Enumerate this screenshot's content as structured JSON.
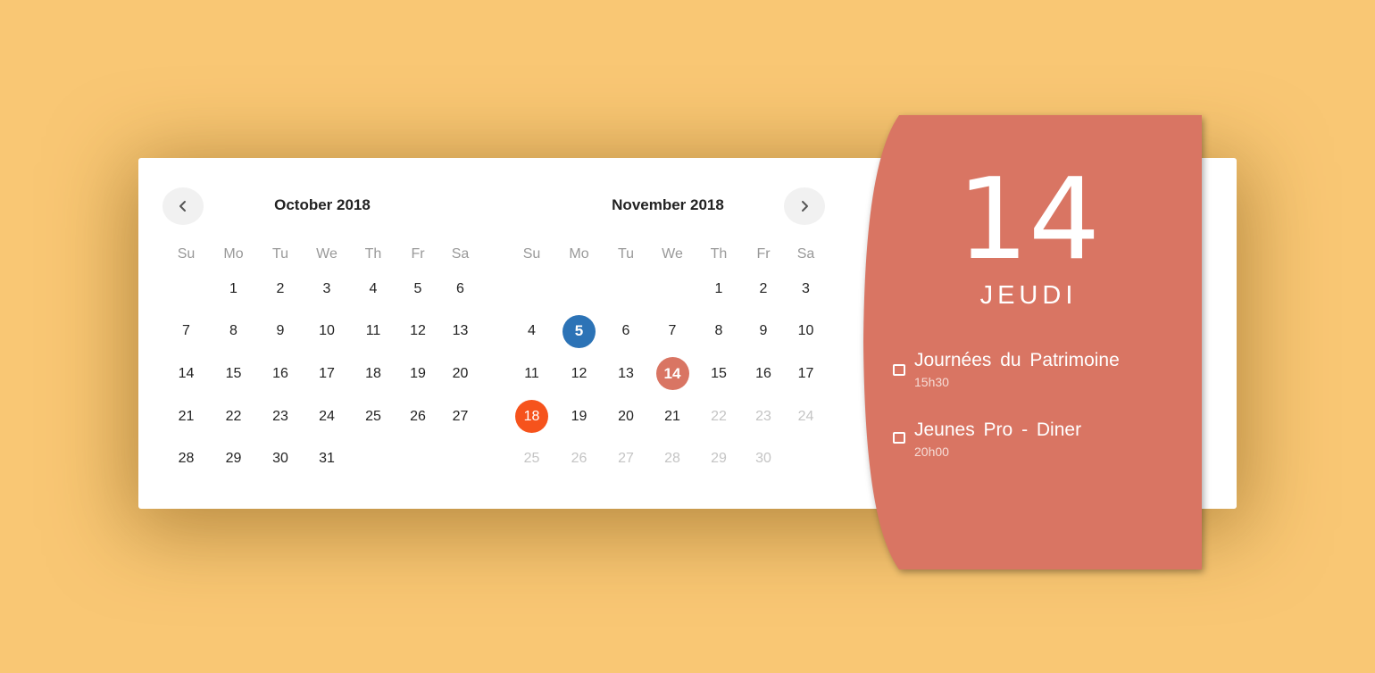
{
  "calendar": {
    "prev_icon": "chevron-left-icon",
    "next_icon": "chevron-right-icon",
    "weekday_labels": [
      "Su",
      "Mo",
      "Tu",
      "We",
      "Th",
      "Fr",
      "Sa"
    ],
    "months": [
      {
        "title": "October 2018",
        "weeks": [
          [
            "",
            "1",
            "2",
            "3",
            "4",
            "5",
            "6"
          ],
          [
            "7",
            "8",
            "9",
            "10",
            "11",
            "12",
            "13"
          ],
          [
            "14",
            "15",
            "16",
            "17",
            "18",
            "19",
            "20"
          ],
          [
            "21",
            "22",
            "23",
            "24",
            "25",
            "26",
            "27"
          ],
          [
            "28",
            "29",
            "30",
            "31",
            "",
            "",
            ""
          ]
        ],
        "muted": [],
        "highlights": {}
      },
      {
        "title": "November 2018",
        "weeks": [
          [
            "",
            "",
            "",
            "",
            "1",
            "2",
            "3"
          ],
          [
            "4",
            "5",
            "6",
            "7",
            "8",
            "9",
            "10"
          ],
          [
            "11",
            "12",
            "13",
            "14",
            "15",
            "16",
            "17"
          ],
          [
            "18",
            "19",
            "20",
            "21",
            "22",
            "23",
            "24"
          ],
          [
            "25",
            "26",
            "27",
            "28",
            "29",
            "30",
            ""
          ]
        ],
        "muted": [
          "22",
          "23",
          "24",
          "25",
          "26",
          "27",
          "28",
          "29",
          "30"
        ],
        "highlights": {
          "5": "blue",
          "14": "salmon",
          "18": "orange"
        }
      }
    ]
  },
  "colors": {
    "background": "#f9c774",
    "panel": "#d97563",
    "highlight_blue": "#2c73b6",
    "highlight_salmon": "#d97563",
    "highlight_orange": "#f6531c"
  },
  "selected": {
    "day": "14",
    "weekday": "JEUDI"
  },
  "events": [
    {
      "title": "Journées du Patrimoine",
      "time": "15h30",
      "icon": "checkbox-icon"
    },
    {
      "title": "Jeunes Pro - Diner",
      "time": "20h00",
      "icon": "checkbox-icon"
    }
  ]
}
